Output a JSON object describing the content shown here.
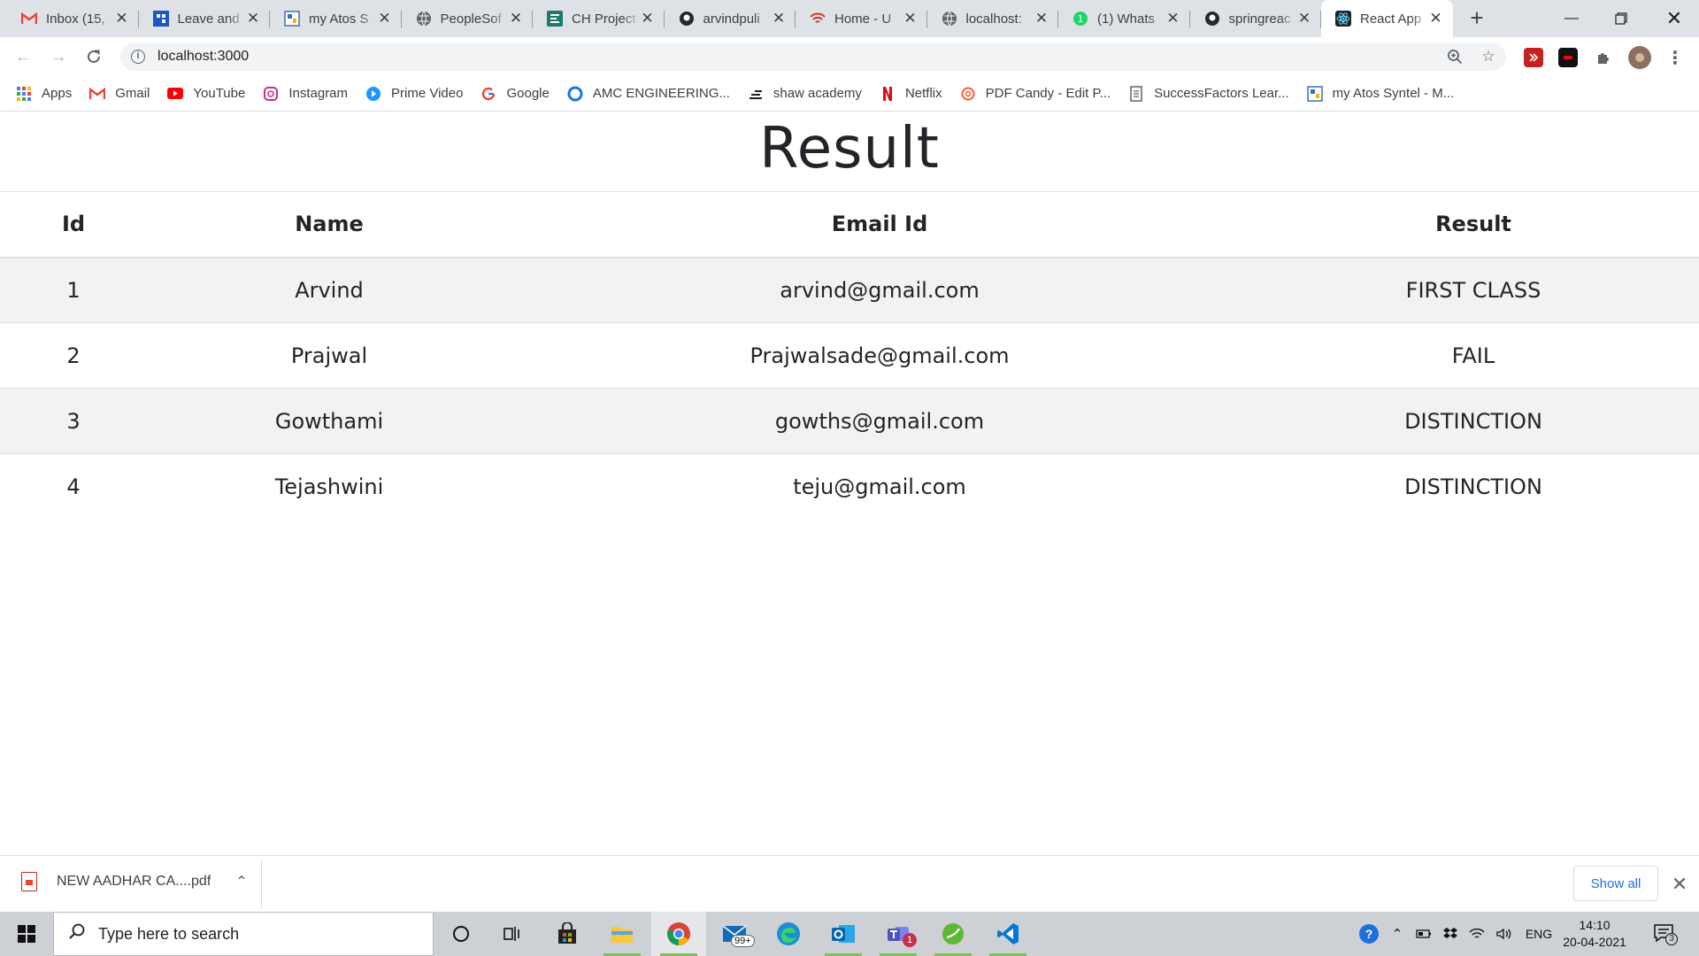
{
  "browser": {
    "tabs": [
      {
        "title": "Inbox (15,",
        "icon": "gmail-icon",
        "color": "#ea4335"
      },
      {
        "title": "Leave and",
        "icon": "leave-icon",
        "color": "#1a56c4"
      },
      {
        "title": "my Atos S",
        "icon": "atos-icon",
        "color": "#3b6fb6"
      },
      {
        "title": "PeopleSof",
        "icon": "globe-icon",
        "color": "#5f6368"
      },
      {
        "title": "CH Project",
        "icon": "project-icon",
        "color": "#1e7a6d"
      },
      {
        "title": "arvindpuli",
        "icon": "github-icon",
        "color": "#24292e"
      },
      {
        "title": "Home - U",
        "icon": "wifi-icon",
        "color": "#d93025"
      },
      {
        "title": "localhost:",
        "icon": "globe-icon",
        "color": "#5f6368"
      },
      {
        "title": "(1) Whats",
        "icon": "whatsapp-icon",
        "color": "#25d366"
      },
      {
        "title": "springreac",
        "icon": "github-icon",
        "color": "#24292e"
      },
      {
        "title": "React App",
        "icon": "react-icon",
        "color": "#20232a"
      }
    ],
    "active_tab_index": 10,
    "url": "localhost:3000",
    "bookmarks": [
      {
        "label": "Apps",
        "icon": "apps-grid-icon",
        "color": "#4285f4"
      },
      {
        "label": "Gmail",
        "icon": "gmail-icon",
        "color": "#ea4335"
      },
      {
        "label": "YouTube",
        "icon": "youtube-icon",
        "color": "#ff0000"
      },
      {
        "label": "Instagram",
        "icon": "instagram-icon",
        "color": "#c13584"
      },
      {
        "label": "Prime Video",
        "icon": "prime-video-icon",
        "color": "#1a98ff"
      },
      {
        "label": "Google",
        "icon": "google-icon",
        "color": "#4285f4"
      },
      {
        "label": "AMC ENGINEERING...",
        "icon": "amc-icon",
        "color": "#1a73e8"
      },
      {
        "label": "shaw academy",
        "icon": "shaw-icon",
        "color": "#202124"
      },
      {
        "label": "Netflix",
        "icon": "netflix-icon",
        "color": "#e50914"
      },
      {
        "label": "PDF Candy - Edit P...",
        "icon": "pdfcandy-icon",
        "color": "#ff5a36"
      },
      {
        "label": "SuccessFactors Lear...",
        "icon": "document-icon",
        "color": "#5f6368"
      },
      {
        "label": "my Atos Syntel - M...",
        "icon": "atos-icon",
        "color": "#3b6fb6"
      }
    ]
  },
  "page": {
    "heading": "Result",
    "columns": [
      "Id",
      "Name",
      "Email Id",
      "Result"
    ],
    "rows": [
      {
        "id": "1",
        "name": "Arvind",
        "email": "arvind@gmail.com",
        "result": "FIRST CLASS"
      },
      {
        "id": "2",
        "name": "Prajwal",
        "email": "Prajwalsade@gmail.com",
        "result": "FAIL"
      },
      {
        "id": "3",
        "name": "Gowthami",
        "email": "gowths@gmail.com",
        "result": "DISTINCTION"
      },
      {
        "id": "4",
        "name": "Tejashwini",
        "email": "teju@gmail.com",
        "result": "DISTINCTION"
      }
    ]
  },
  "download_shelf": {
    "file_name": "NEW AADHAR CA....pdf",
    "show_all": "Show all"
  },
  "taskbar": {
    "search_placeholder": "Type here to search",
    "mail_badge": "99+",
    "teams_badge": "1",
    "language": "ENG",
    "time": "14:10",
    "date": "20-04-2021",
    "notification_count": "3"
  }
}
